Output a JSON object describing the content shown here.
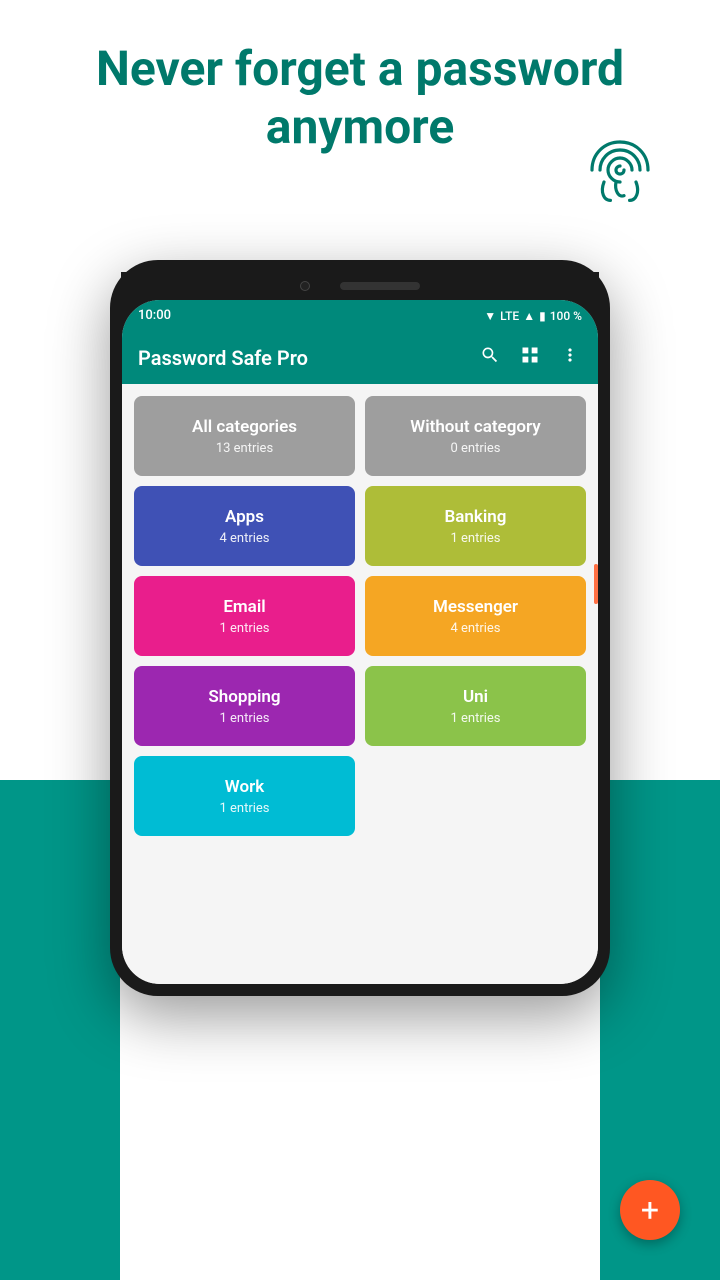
{
  "page": {
    "headline_line1": "Never forget a password",
    "headline_line2": "anymore",
    "background_color": "#009688"
  },
  "status_bar": {
    "time": "10:00",
    "lte": "LTE",
    "battery": "100 %"
  },
  "app_bar": {
    "title": "Password Safe Pro",
    "icons": {
      "search": "🔍",
      "grid": "⊞",
      "more": "⋮"
    }
  },
  "categories": [
    {
      "name": "All categories",
      "entries": "13 entries",
      "color_class": "card-all"
    },
    {
      "name": "Without category",
      "entries": "0 entries",
      "color_class": "card-without"
    },
    {
      "name": "Apps",
      "entries": "4 entries",
      "color_class": "card-apps"
    },
    {
      "name": "Banking",
      "entries": "1 entries",
      "color_class": "card-banking"
    },
    {
      "name": "Email",
      "entries": "1 entries",
      "color_class": "card-email"
    },
    {
      "name": "Messenger",
      "entries": "4 entries",
      "color_class": "card-messenger"
    },
    {
      "name": "Shopping",
      "entries": "1 entries",
      "color_class": "card-shopping"
    },
    {
      "name": "Uni",
      "entries": "1 entries",
      "color_class": "card-uni"
    },
    {
      "name": "Work",
      "entries": "1 entries",
      "color_class": "card-work",
      "full_row": false
    }
  ],
  "fab": {
    "label": "+",
    "color": "#FF5722"
  }
}
